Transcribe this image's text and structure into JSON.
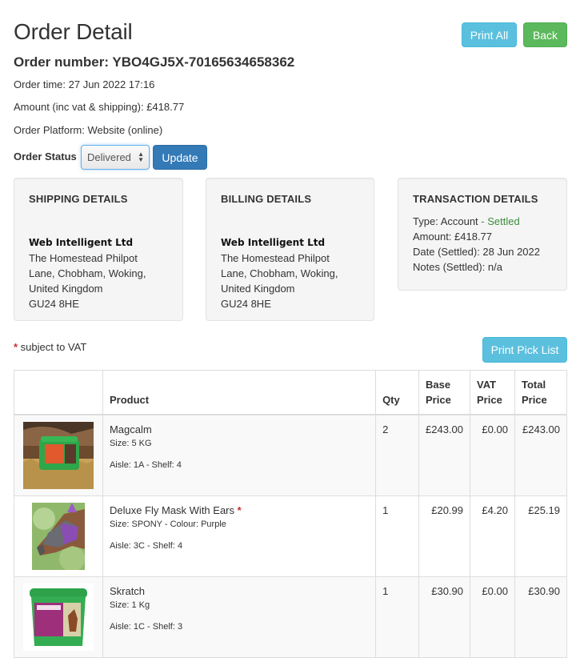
{
  "header": {
    "title": "Order Detail",
    "order_number": "Order number: YBO4GJ5X-70165634658362",
    "order_time": "Order time: 27 Jun 2022 17:16",
    "amount": "Amount (inc vat & shipping): £418.77",
    "platform": "Order Platform: Website (online)",
    "print_all_label": "Print All",
    "back_label": "Back"
  },
  "status": {
    "label": "Order Status",
    "selected": "Delivered",
    "update_label": "Update"
  },
  "shipping": {
    "title": "SHIPPING DETAILS",
    "company": "Web Intelligent Ltd",
    "lines": [
      "The Homestead Philpot",
      "Lane, Chobham, Woking,",
      "United Kingdom",
      "GU24 8HE"
    ]
  },
  "billing": {
    "title": "BILLING DETAILS",
    "company": "Web Intelligent Ltd",
    "lines": [
      "The Homestead Philpot",
      "Lane, Chobham, Woking,",
      "United Kingdom",
      "GU24 8HE"
    ]
  },
  "transaction": {
    "title": "TRANSACTION DETAILS",
    "type": "Type: Account",
    "type_status": " - Settled",
    "amount": "Amount: £418.77",
    "date": "Date (Settled): 28 Jun 2022",
    "notes": "Notes (Settled): n/a"
  },
  "vat_note": {
    "marker": "*",
    "text": " subject to VAT"
  },
  "print_pick_list_label": "Print Pick List",
  "table": {
    "headers": {
      "image": "",
      "product": "Product",
      "qty": "Qty",
      "base_line1": "Base",
      "base_line2": "Price",
      "vat_line1": "VAT",
      "vat_line2": "Price",
      "total_line1": "Total",
      "total_line2": "Price"
    },
    "rows": [
      {
        "name": "Magcalm",
        "vat_marker": "",
        "size": "Size: 5 KG",
        "aisle": "Aisle: 1A - Shelf: 4",
        "qty": "2",
        "base": "£243.00",
        "vat": "£0.00",
        "total": "£243.00",
        "image": "green-supplement-tub-on-straw"
      },
      {
        "name": "Deluxe Fly Mask With Ears",
        "vat_marker": "*",
        "size": "Size: SPONY - Colour: Purple",
        "aisle": "Aisle: 3C - Shelf: 4",
        "qty": "1",
        "base": "£20.99",
        "vat": "£4.20",
        "total": "£25.19",
        "image": "horse-wearing-purple-fly-mask"
      },
      {
        "name": "Skratch",
        "vat_marker": "",
        "size": "Size: 1 Kg",
        "aisle": "Aisle: 1C - Shelf: 3",
        "qty": "1",
        "base": "£30.90",
        "vat": "£0.00",
        "total": "£30.90",
        "image": "green-skratch-tub"
      }
    ]
  },
  "colors": {
    "info": "#5bc0de",
    "success": "#5cb85c",
    "primary": "#337ab7",
    "settled": "#3c8c3c",
    "required": "#c9302c"
  }
}
